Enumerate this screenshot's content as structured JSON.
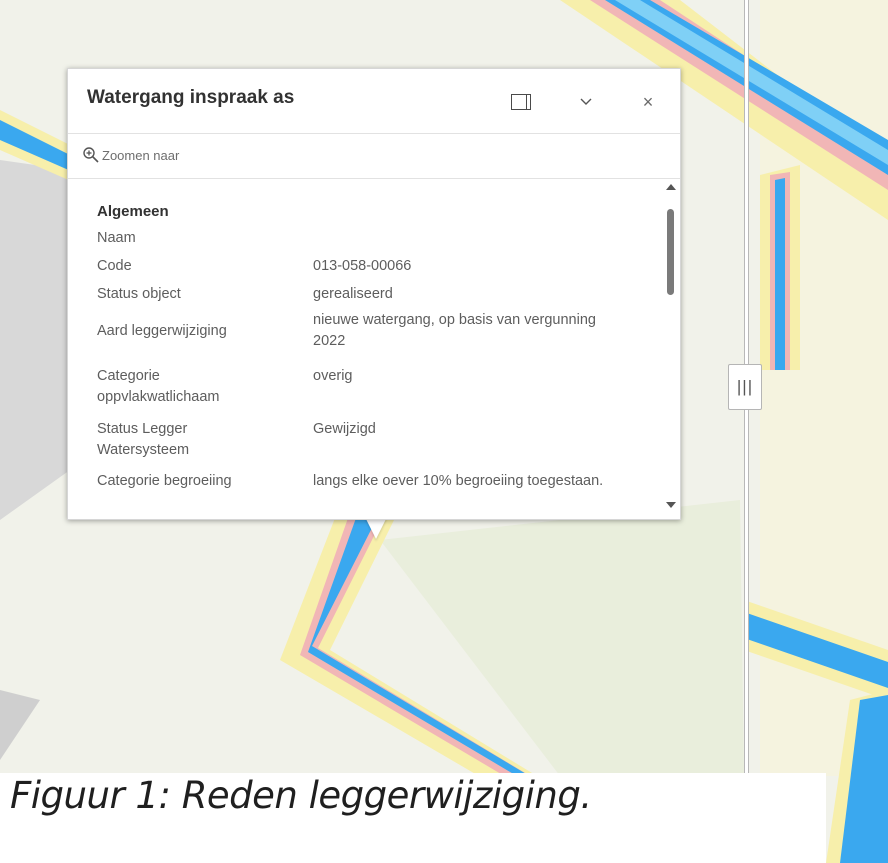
{
  "popup": {
    "title": "Watergang inspraak as",
    "dock_icon": "dock-panel-icon",
    "collapse_icon": "chevron-down-icon",
    "close_icon": "close-icon",
    "close_glyph": "×",
    "collapse_glyph": "⌄",
    "zoom_icon": "zoom-in-icon",
    "zoom_label": "Zoomen naar",
    "section_title": "Algemeen",
    "fields": [
      {
        "label": "Naam",
        "value": ""
      },
      {
        "label": "Code",
        "value": "013-058-00066"
      },
      {
        "label": "Status object",
        "value": "gerealiseerd"
      },
      {
        "label": "Aard leggerwijziging",
        "value": "nieuwe watergang, op basis van vergunning 2022"
      },
      {
        "label": "Categorie oppvlakwatlichaam",
        "value": "overig"
      },
      {
        "label": "Status Legger Watersysteem",
        "value": "Gewijzigd"
      },
      {
        "label": "Categorie begroeiing",
        "value": "langs elke oever 10% begroeiing toegestaan."
      }
    ]
  },
  "swipe": {
    "handle_glyph": "|||"
  },
  "caption": "Figuur 1: Reden leggerwijziging.",
  "colors": {
    "water": "#3fa9f5",
    "water_light": "#8fd6f7",
    "pink_band": "#f2b5b5",
    "yellow_band": "#f7f1a8",
    "terrain": "#eef1e3"
  }
}
